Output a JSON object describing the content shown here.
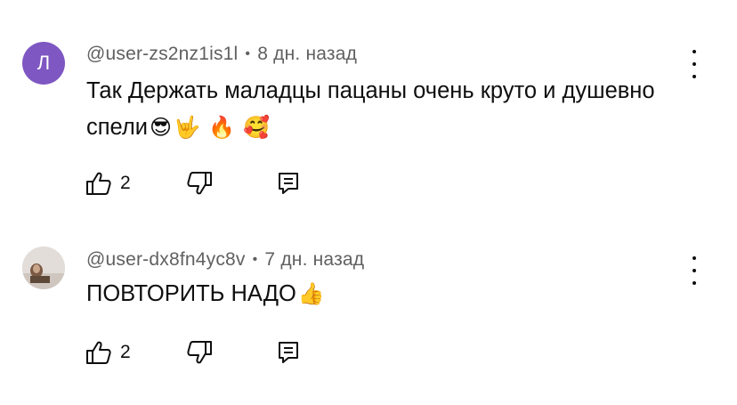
{
  "comments": [
    {
      "avatar_letter": "Л",
      "author": "@user-zs2nz1is1l",
      "separator": "•",
      "time": "8 дн. назад",
      "text": "Так Держать маладцы пацаны очень круто и душевно спели",
      "emojis": [
        "😎",
        "🤟",
        "🔥",
        "🥰"
      ],
      "likes": "2"
    },
    {
      "author": "@user-dx8fn4yc8v",
      "separator": "•",
      "time": "7 дн. назад",
      "text": "ПОВТОРИТЬ НАДО",
      "emojis": [
        "👍"
      ],
      "likes": "2"
    }
  ],
  "colors": {
    "avatar_purple": "#7e57c2",
    "meta_gray": "#606060",
    "text": "#0f0f0f"
  },
  "icons": [
    "thumb-up-icon",
    "thumb-down-icon",
    "reply-icon",
    "more-vert-icon"
  ]
}
